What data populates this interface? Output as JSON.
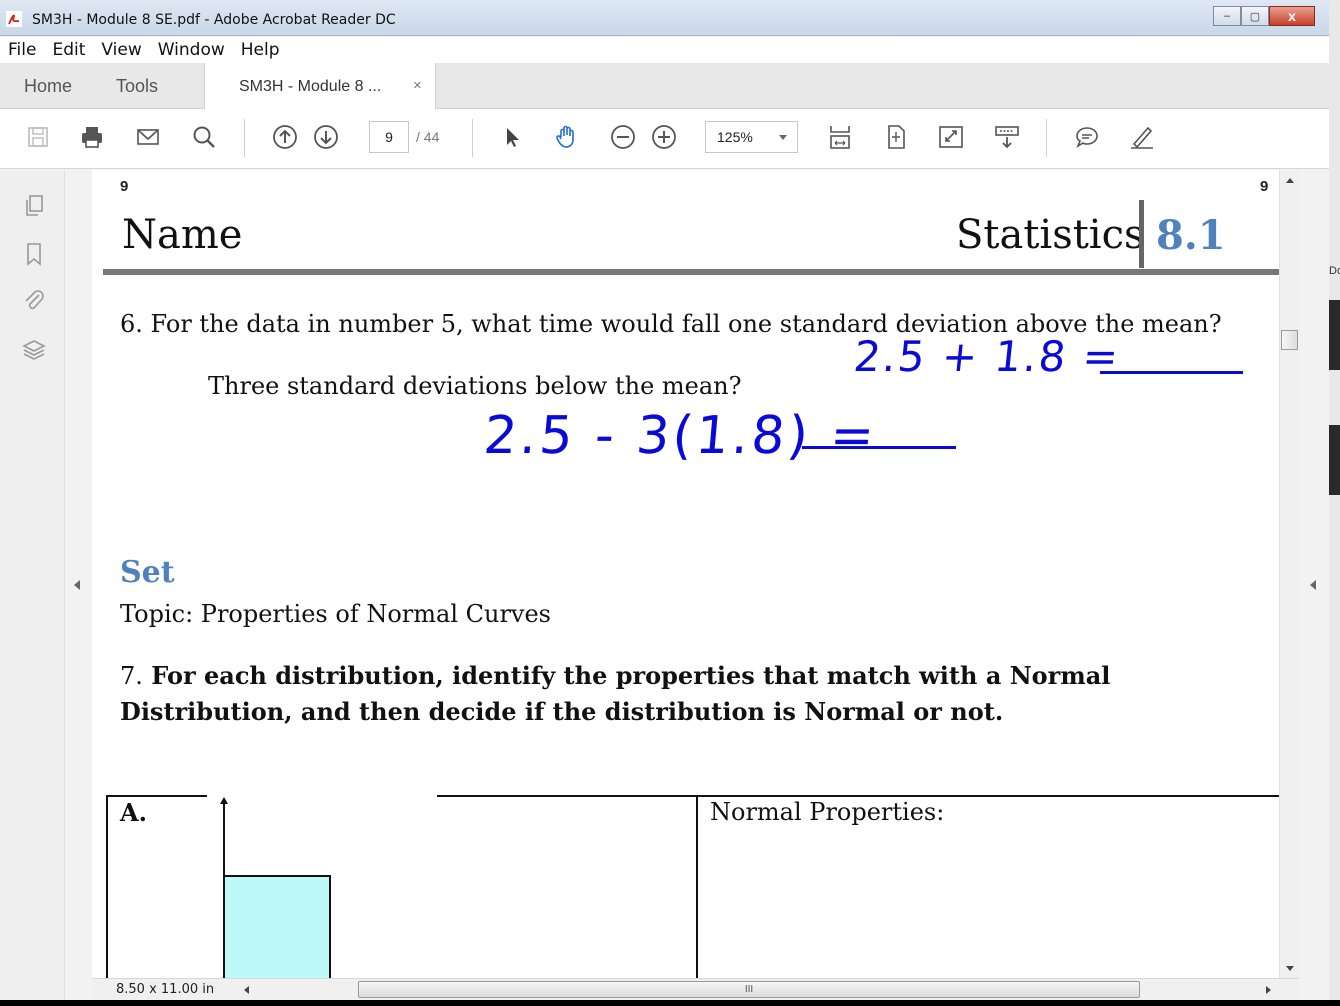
{
  "window": {
    "title": "SM3H - Module 8 SE.pdf - Adobe Acrobat Reader DC",
    "controls": {
      "minimize": "–",
      "maximize": "▢",
      "close": "x"
    }
  },
  "menu": [
    "File",
    "Edit",
    "View",
    "Window",
    "Help"
  ],
  "tabs": {
    "home": "Home",
    "tools": "Tools",
    "document": "SM3H - Module 8 ...",
    "close": "×"
  },
  "toolbar": {
    "page_current": "9",
    "page_total": "/ 44",
    "zoom": "125%",
    "icons": [
      "save-icon",
      "print-icon",
      "email-icon",
      "search-icon",
      "prev-page-icon",
      "next-page-icon",
      "select-icon",
      "hand-icon",
      "zoom-out-icon",
      "zoom-in-icon",
      "scroll-mode-icon",
      "fit-page-icon",
      "fullscreen-icon",
      "read-mode-icon",
      "comment-icon",
      "sign-icon"
    ]
  },
  "leftnav": {
    "icons": [
      "page-thumbnails-icon",
      "bookmarks-icon",
      "attachments-icon",
      "layers-icon"
    ]
  },
  "page": {
    "page_number_left": "9",
    "page_number_right": "9",
    "header": {
      "name": "Name",
      "subject": "Statistics",
      "section": "8.1"
    },
    "q6": "6.  For the data in number 5, what time would fall one standard deviation above the mean?",
    "q6_sub": "Three standard deviations below the mean?",
    "handwriting_1": "2.5 + 1.8 =",
    "handwriting_2": "2.5 - 3(1.8) =",
    "set_label": "Set",
    "topic": "Topic: Properties of Normal Curves",
    "q7_number": "7.",
    "q7": "For each distribution, identify the properties that match with a Normal Distribution, and then decide if the distribution is Normal or not.",
    "table": {
      "cell_a": "A.",
      "normal_properties": "Normal Properties:"
    },
    "histogram_bar_color": "#bff8f8"
  },
  "status": {
    "page_size": "8.50 x 11.00 in",
    "grip": "III"
  },
  "colors": {
    "accent_blue": "#4f81bd",
    "ink": "#0a0ad8"
  }
}
